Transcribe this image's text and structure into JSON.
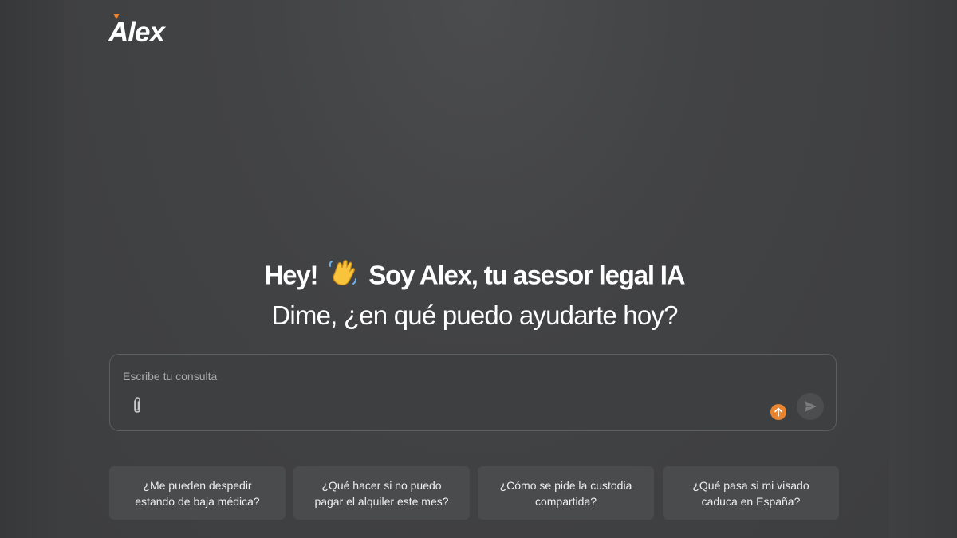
{
  "app": {
    "logo_text": "Alex",
    "accent_color": "#e8842f"
  },
  "hero": {
    "title_prefix": "Hey!",
    "title_emoji": "waving-hand-icon",
    "title_suffix": "Soy Alex, tu asesor legal IA",
    "subtitle": "Dime, ¿en qué puedo ayudarte hoy?"
  },
  "composer": {
    "placeholder": "Escribe tu consulta",
    "value": "",
    "attach_icon": "paperclip-icon",
    "upload_icon": "arrow-up-icon",
    "send_icon": "send-icon"
  },
  "suggestions": [
    {
      "label": "¿Me pueden despedir\nestando de baja médica?"
    },
    {
      "label": "¿Qué hacer si no puedo\npagar el alquiler este mes?"
    },
    {
      "label": "¿Cómo se pide la custodia\ncompartida?"
    },
    {
      "label": "¿Qué pasa si mi visado\ncaduca en España?"
    }
  ]
}
